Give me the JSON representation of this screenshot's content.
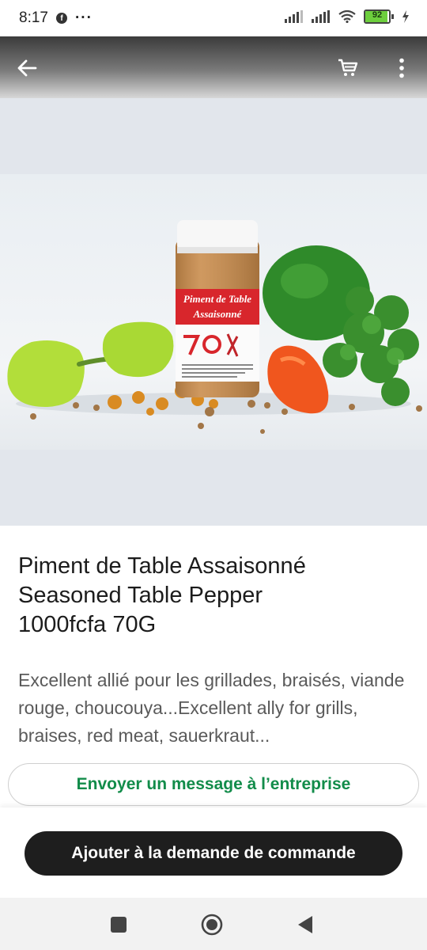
{
  "status_bar": {
    "time": "8:17",
    "facebook_icon": "facebook-icon",
    "more_notifications": "···",
    "battery_level": "92",
    "battery_fraction": 0.92
  },
  "app_bar": {
    "back_icon": "arrow-back-icon",
    "cart_icon": "shopping-cart-icon",
    "menu_icon": "more-vertical-icon"
  },
  "product": {
    "image_name": "product-photo",
    "jar_label_line1": "Piment de Table",
    "jar_label_line2": "Assaisonné",
    "title_line1": "Piment de Table Assaisonné",
    "title_line2": "Seasoned Table Pepper",
    "title_line3": "1000fcfa 70G",
    "description": "Excellent allié pour les grillades, braisés, viande rouge, choucouya...Excellent ally for grills, braises, red meat, sauerkraut..."
  },
  "actions": {
    "message_label": "Envoyer un message à l’entreprise",
    "order_label": "Ajouter à la demande de commande"
  },
  "colors": {
    "accent_green": "#128c4a",
    "primary_button": "#1e1e1e"
  },
  "nav": {
    "recents_icon": "square-icon",
    "home_icon": "circle-home-icon",
    "back_icon": "triangle-back-icon"
  }
}
